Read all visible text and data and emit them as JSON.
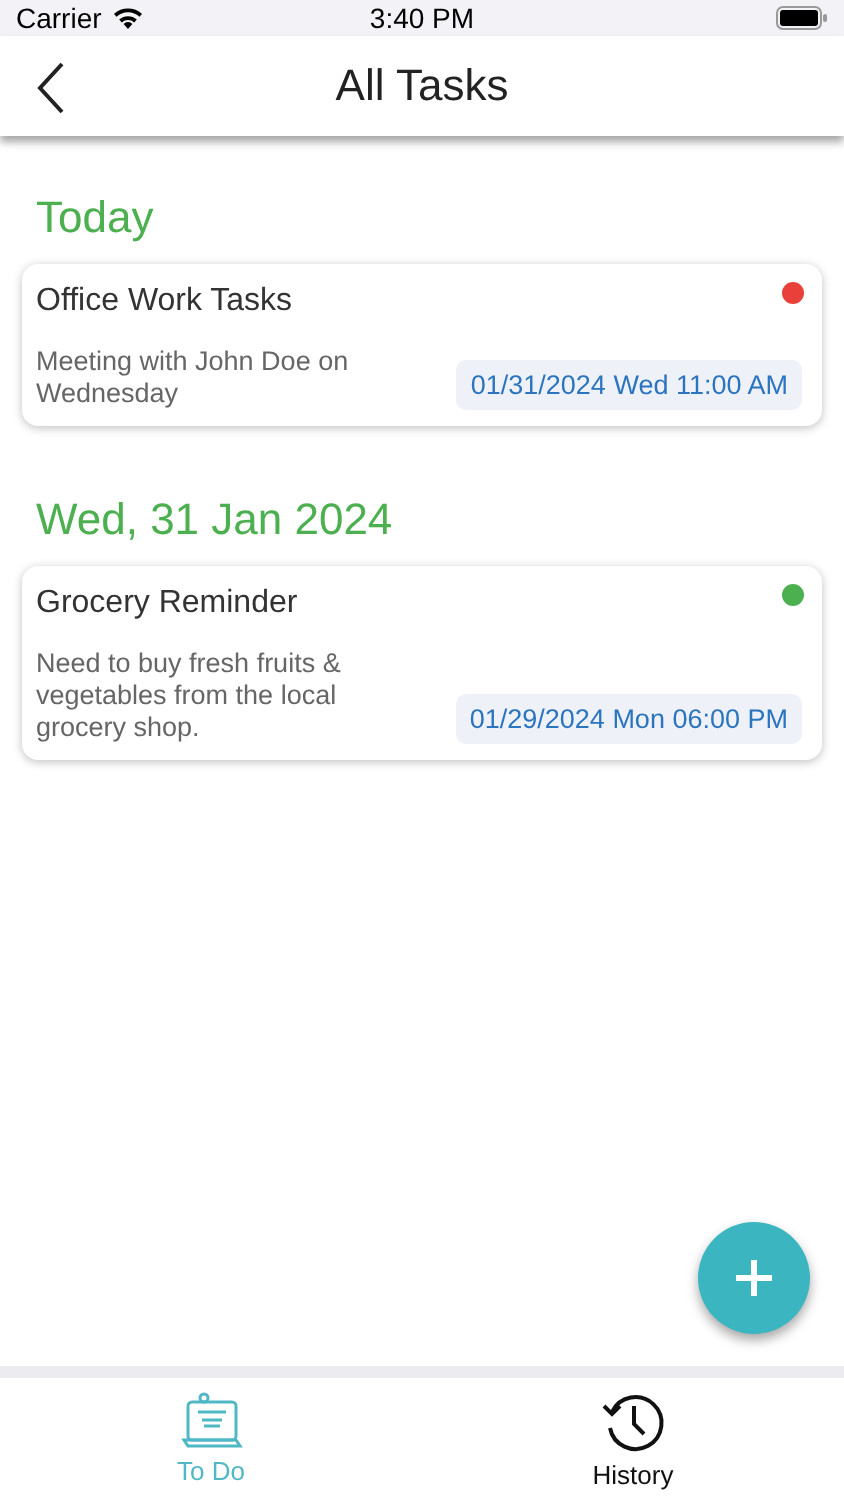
{
  "status_bar": {
    "carrier": "Carrier",
    "time": "3:40 PM"
  },
  "nav": {
    "title": "All Tasks"
  },
  "sections": [
    {
      "heading": "Today",
      "tasks": [
        {
          "title": "Office Work Tasks",
          "description": "Meeting with John Doe on Wednesday",
          "due": "01/31/2024 Wed 11:00 AM",
          "color": "#e9413a"
        }
      ]
    },
    {
      "heading": "Wed, 31 Jan 2024",
      "tasks": [
        {
          "title": "Grocery Reminder",
          "description": "Need to buy fresh fruits & vegetables from the local grocery shop.",
          "due": "01/29/2024 Mon 06:00 PM",
          "color": "#4caf50"
        }
      ]
    }
  ],
  "tab_bar": [
    {
      "label": "To Do",
      "kind": "todo",
      "selected": true
    },
    {
      "label": "History",
      "kind": "history",
      "selected": false
    }
  ]
}
